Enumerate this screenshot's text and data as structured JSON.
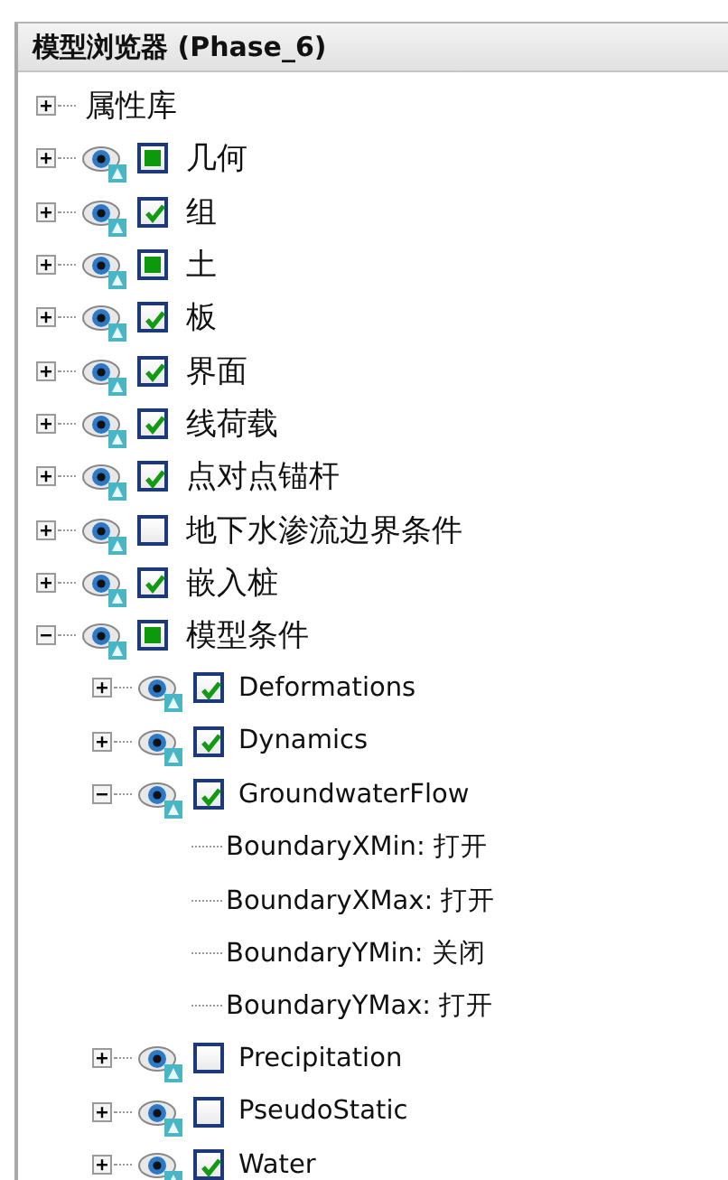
{
  "panel": {
    "title": "模型浏览器 (Phase_6)"
  },
  "tree": [
    {
      "kind": "folder",
      "label": "属性库",
      "expanded": false
    },
    {
      "kind": "layer",
      "label": "几何",
      "checked": false,
      "partial": true,
      "expanded": false
    },
    {
      "kind": "layer",
      "label": "组",
      "checked": true,
      "partial": false,
      "expanded": false
    },
    {
      "kind": "layer",
      "label": "土",
      "checked": false,
      "partial": true,
      "expanded": false
    },
    {
      "kind": "layer",
      "label": "板",
      "checked": true,
      "partial": false,
      "expanded": false
    },
    {
      "kind": "layer",
      "label": "界面",
      "checked": true,
      "partial": false,
      "expanded": false
    },
    {
      "kind": "layer",
      "label": "线荷载",
      "checked": true,
      "partial": false,
      "expanded": false
    },
    {
      "kind": "layer",
      "label": "点对点锚杆",
      "checked": true,
      "partial": false,
      "expanded": false
    },
    {
      "kind": "layer",
      "label": "地下水渗流边界条件",
      "checked": false,
      "partial": false,
      "expanded": false
    },
    {
      "kind": "layer",
      "label": "嵌入桩",
      "checked": true,
      "partial": false,
      "expanded": false
    },
    {
      "kind": "layer",
      "label": "模型条件",
      "checked": false,
      "partial": true,
      "expanded": true,
      "children": [
        {
          "kind": "layer",
          "label": "Deformations",
          "checked": true,
          "partial": false,
          "expanded": false
        },
        {
          "kind": "layer",
          "label": "Dynamics",
          "checked": true,
          "partial": false,
          "expanded": false
        },
        {
          "kind": "layer",
          "label": "GroundwaterFlow",
          "checked": true,
          "partial": false,
          "expanded": true,
          "children": [
            {
              "kind": "property",
              "label": "BoundaryXMin: 打开"
            },
            {
              "kind": "property",
              "label": "BoundaryXMax: 打开"
            },
            {
              "kind": "property",
              "label": "BoundaryYMin: 关闭"
            },
            {
              "kind": "property",
              "label": "BoundaryYMax: 打开"
            }
          ]
        },
        {
          "kind": "layer",
          "label": "Precipitation",
          "checked": false,
          "partial": false,
          "expanded": false
        },
        {
          "kind": "layer",
          "label": "PseudoStatic",
          "checked": false,
          "partial": false,
          "expanded": false
        },
        {
          "kind": "layer",
          "label": "Water",
          "checked": true,
          "partial": false,
          "expanded": false
        }
      ]
    }
  ]
}
